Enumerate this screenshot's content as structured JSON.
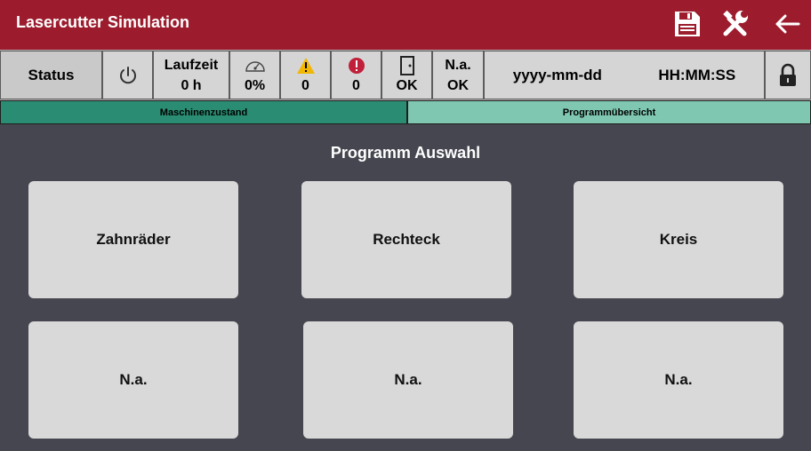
{
  "header": {
    "title": "Lasercutter Simulation",
    "icons": [
      "save-icon",
      "tools-icon",
      "back-arrow-icon"
    ]
  },
  "status_bar": {
    "status_label": "Status",
    "power_icon": "power-icon",
    "runtime_label": "Laufzeit",
    "runtime_value": "0 h",
    "load_icon": "speedometer-icon",
    "load_value": "0%",
    "warning_icon": "warning-icon",
    "warning_count": "0",
    "error_icon": "error-icon",
    "error_count": "0",
    "door_icon": "door-icon",
    "door_status": "OK",
    "na_label": "N.a.",
    "na_status": "OK",
    "date": "yyyy-mm-dd",
    "time": "HH:MM:SS",
    "lock_icon": "lock-icon"
  },
  "tabs": [
    {
      "label": "Maschinenzustand",
      "color": "#2a8c72"
    },
    {
      "label": "Programmübersicht",
      "color": "#7fc7b1"
    }
  ],
  "main": {
    "title": "Programm Auswahl",
    "programs": [
      {
        "label": "Zahnräder"
      },
      {
        "label": "Rechteck"
      },
      {
        "label": "Kreis"
      },
      {
        "label": "N.a."
      },
      {
        "label": "N.a."
      },
      {
        "label": "N.a."
      }
    ]
  },
  "colors": {
    "header_bg": "#9c1c2d",
    "page_bg": "#45464f",
    "warning": "#f2b705",
    "error": "#c0203a"
  }
}
